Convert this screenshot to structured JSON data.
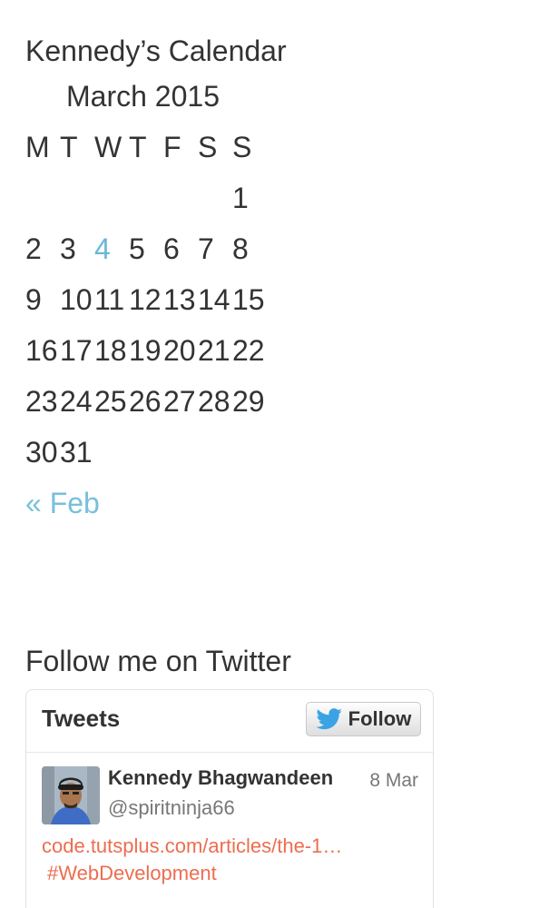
{
  "calendar": {
    "title": "Kennedy’s Calendar",
    "caption": "March 2015",
    "weekdays": [
      "M",
      "T",
      "W",
      "T",
      "F",
      "S",
      "S"
    ],
    "weeks": [
      [
        "",
        "",
        "",
        "",
        "",
        "",
        "1"
      ],
      [
        "2",
        "3",
        "4",
        "5",
        "6",
        "7",
        "8"
      ],
      [
        "9",
        "10",
        "11",
        "12",
        "13",
        "14",
        "15"
      ],
      [
        "16",
        "17",
        "18",
        "19",
        "20",
        "21",
        "22"
      ],
      [
        "23",
        "24",
        "25",
        "26",
        "27",
        "28",
        "29"
      ],
      [
        "30",
        "31",
        "",
        "",
        "",
        "",
        ""
      ]
    ],
    "today": "4",
    "prev_link": "« Feb",
    "today_color": "#68b8d6",
    "link_color": "#76c0da"
  },
  "twitter": {
    "title": "Follow me on Twitter",
    "heading": "Tweets",
    "follow_label": "Follow",
    "bird_icon": "twitter-bird-icon",
    "tweet": {
      "author": "Kennedy Bhagwandeen",
      "date": "8 Mar",
      "handle": "@spiritninja66",
      "link": "code.tutsplus.com/articles/the-1…",
      "hashtag": "#WebDevelopment",
      "link_color": "#ed6d50"
    }
  }
}
